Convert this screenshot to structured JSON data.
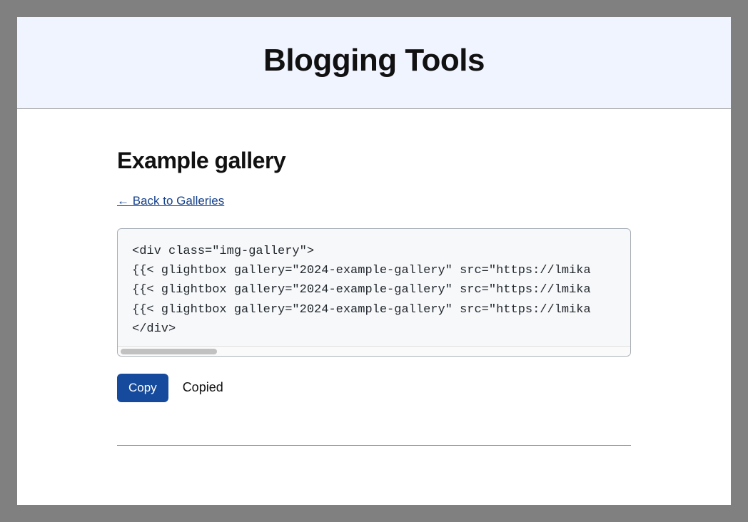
{
  "header": {
    "title": "Blogging Tools"
  },
  "page": {
    "title": "Example gallery",
    "back_link_text": "← Back to Galleries"
  },
  "code": {
    "content": "<div class=\"img-gallery\">\n{{< glightbox gallery=\"2024-example-gallery\" src=\"https://lmika\n{{< glightbox gallery=\"2024-example-gallery\" src=\"https://lmika\n{{< glightbox gallery=\"2024-example-gallery\" src=\"https://lmika\n</div>"
  },
  "actions": {
    "copy_label": "Copy",
    "status_text": "Copied"
  }
}
